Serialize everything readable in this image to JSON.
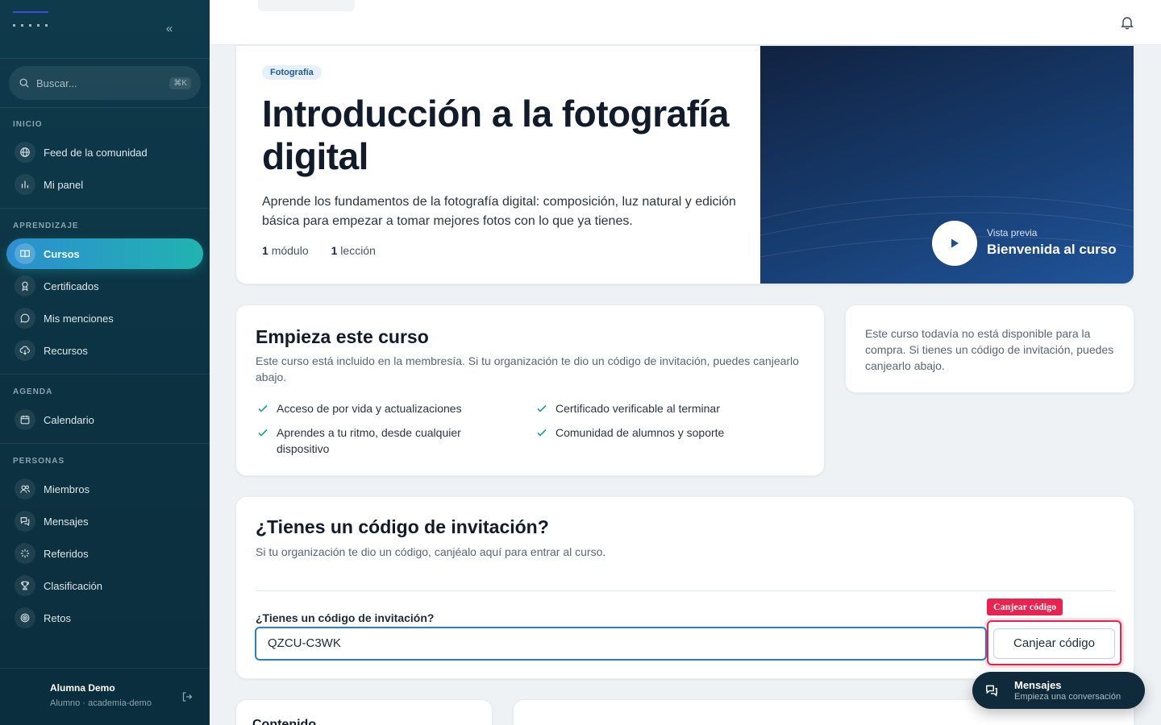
{
  "sidebar": {
    "search_placeholder": "Buscar...",
    "search_shortcut": "⌘K",
    "sections": [
      {
        "label": "INICIO",
        "items": [
          {
            "label": "Feed de la comunidad",
            "icon": "globe-icon"
          },
          {
            "label": "Mi panel",
            "icon": "bar-chart-icon"
          }
        ]
      },
      {
        "label": "APRENDIZAJE",
        "items": [
          {
            "label": "Cursos",
            "icon": "book-icon",
            "active": true
          },
          {
            "label": "Certificados",
            "icon": "award-icon"
          },
          {
            "label": "Mis menciones",
            "icon": "chat-bubble-icon"
          },
          {
            "label": "Recursos",
            "icon": "cloud-download-icon"
          }
        ]
      },
      {
        "label": "AGENDA",
        "items": [
          {
            "label": "Calendario",
            "icon": "calendar-icon"
          }
        ]
      },
      {
        "label": "PERSONAS",
        "items": [
          {
            "label": "Miembros",
            "icon": "users-icon"
          },
          {
            "label": "Mensajes",
            "icon": "messages-icon"
          },
          {
            "label": "Referidos",
            "icon": "sparkle-icon"
          },
          {
            "label": "Clasificación",
            "icon": "trophy-icon"
          },
          {
            "label": "Retos",
            "icon": "target-icon"
          }
        ]
      }
    ],
    "user": {
      "name": "Alumna Demo",
      "meta": "Alumno · academia-demo"
    }
  },
  "hero": {
    "tag": "Fotografía",
    "title": "Introducción a la fotografía digital",
    "description": "Aprende los fundamentos de la fotografía digital: composición, luz natural y edición básica para empezar a tomar mejores fotos con lo que ya tienes.",
    "modules_count": "1",
    "modules_label": "módulo",
    "lessons_count": "1",
    "lessons_label": "lección",
    "preview_small": "Vista previa",
    "preview_title": "Bienvenida al curso"
  },
  "start": {
    "title": "Empieza este curso",
    "subtitle": "Este curso está incluido en la membresía. Si tu organización te dio un código de invitación, puedes canjearlo abajo.",
    "features": [
      "Acceso de por vida y actualizaciones",
      "Certificado verificable al terminar",
      "Aprendes a tu ritmo, desde cualquier dispositivo",
      "Comunidad de alumnos y soporte"
    ]
  },
  "notice": {
    "text": "Este curso todavía no está disponible para la compra. Si tienes un código de invitación, puedes canjearlo abajo."
  },
  "invite": {
    "title": "¿Tienes un código de invitación?",
    "subtitle": "Si tu organización te dio un código, canjéalo aquí para entrar al curso.",
    "field_label": "¿Tienes un código de invitación?",
    "field_value": "QZCU-C3WK",
    "button_label": "Canjear código",
    "badge_label": "Canjear código"
  },
  "bottom": {
    "contenido_title": "Contenido"
  },
  "messages_pill": {
    "title": "Mensajes",
    "subtitle": "Empieza una conversación"
  },
  "colors": {
    "sidebar_bg": "#0e3a4b",
    "active_gradient_start": "#2b8fd0",
    "active_gradient_end": "#22b3b0",
    "highlight": "#e8234f",
    "input_focus": "#2a80c7"
  }
}
